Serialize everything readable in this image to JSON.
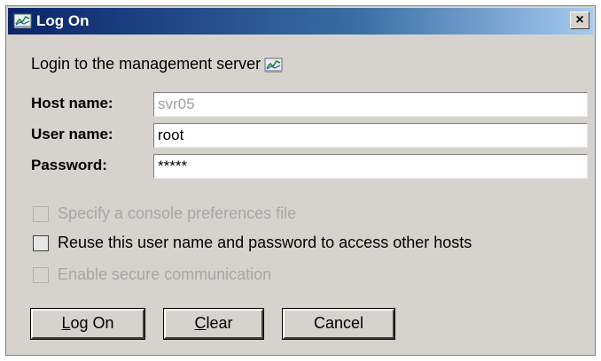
{
  "window": {
    "title": "Log On",
    "close_label": "×"
  },
  "intro": {
    "text": "Login to the management server"
  },
  "fields": {
    "host": {
      "label": "Host name:",
      "value": "svr05"
    },
    "user": {
      "label": "User name:",
      "value": "root"
    },
    "password": {
      "label": "Password:",
      "value": "*****"
    }
  },
  "options": {
    "console_prefs": {
      "label": "Specify a console preferences file",
      "enabled": false,
      "checked": false
    },
    "reuse": {
      "label": "Reuse this user name and password to access other hosts",
      "enabled": true,
      "checked": false
    },
    "secure": {
      "label": "Enable secure communication",
      "enabled": false,
      "checked": false
    }
  },
  "buttons": {
    "logon": {
      "mnemonic": "L",
      "rest": "og On"
    },
    "clear": {
      "mnemonic": "C",
      "rest": "lear"
    },
    "cancel": {
      "label": "Cancel"
    }
  },
  "colors": {
    "title_start": "#0a246a",
    "title_end": "#a6caf0",
    "dialog_bg": "#d6d3ce"
  },
  "icons": {
    "title": "monitor-chart-icon",
    "intro": "monitor-chart-icon"
  }
}
